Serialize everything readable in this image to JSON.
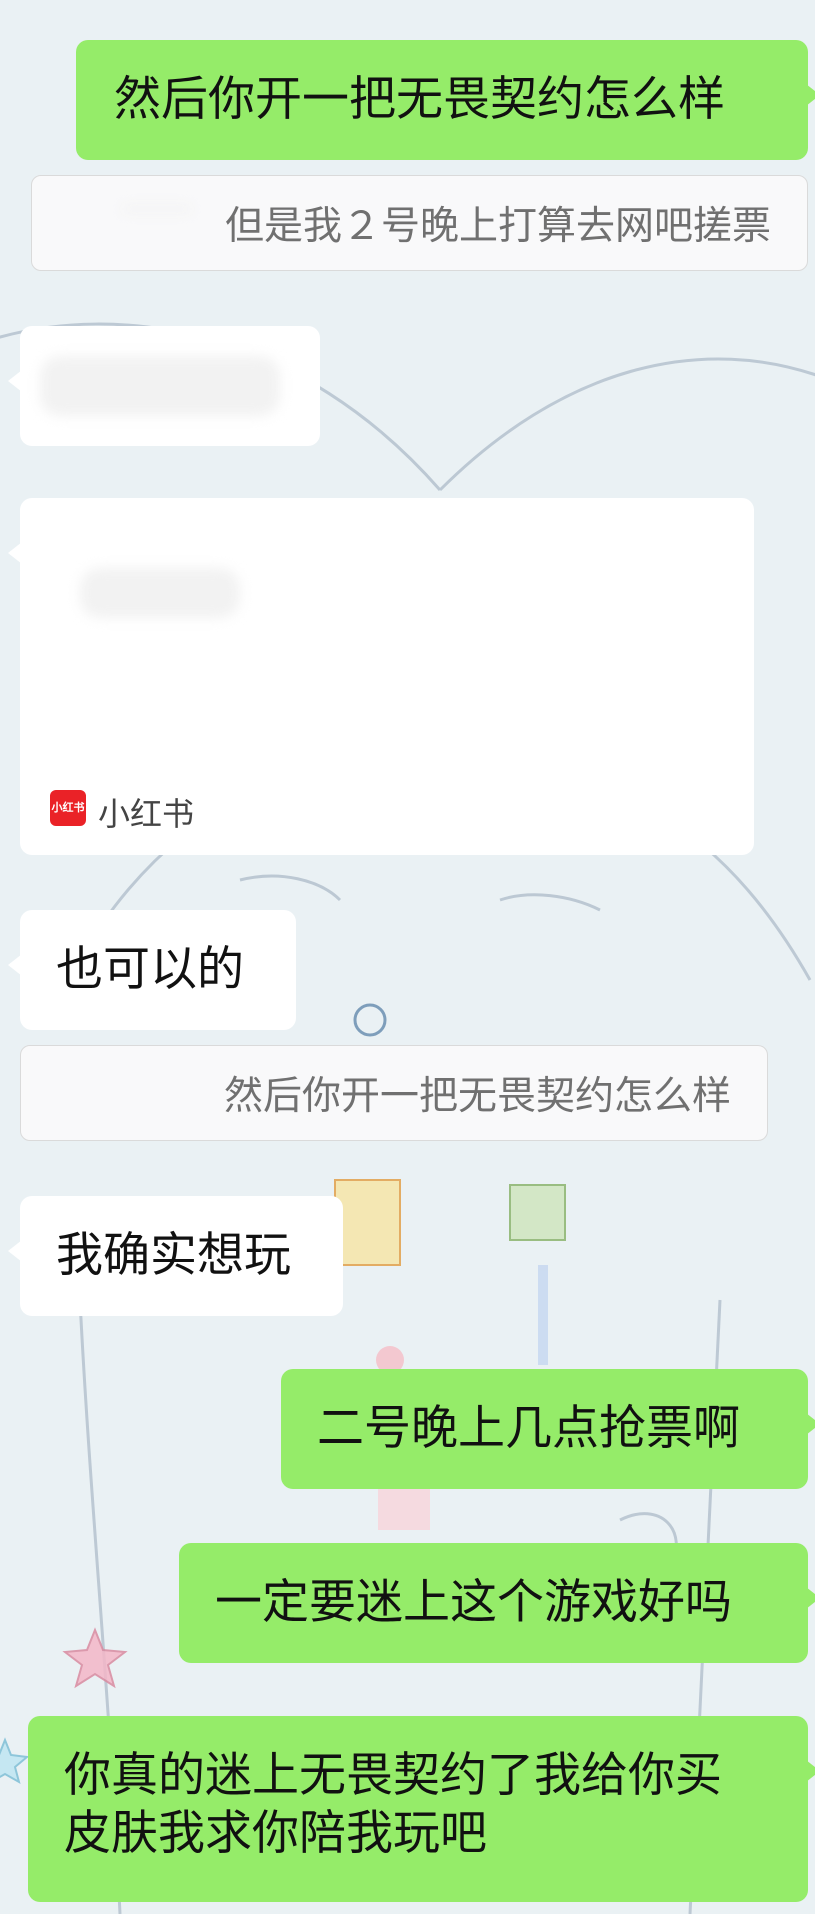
{
  "messages": [
    {
      "side": "right",
      "text": "然后你开一把无畏契约怎么样"
    },
    {
      "side": "right-quote",
      "text": "但是我２号晚上打算去网吧搓票"
    },
    {
      "side": "left",
      "text": ""
    },
    {
      "side": "left-card",
      "source": "小红书",
      "source_logo": "小红书"
    },
    {
      "side": "left",
      "text": "也可以的"
    },
    {
      "side": "left-quote",
      "text": "然后你开一把无畏契约怎么样"
    },
    {
      "side": "left",
      "text": "我确实想玩"
    },
    {
      "side": "right",
      "text": "二号晚上几点抢票啊"
    },
    {
      "side": "right",
      "text": "一定要迷上这个游戏好吗"
    },
    {
      "side": "right",
      "line1": "你真的迷上无畏契约了我给你买",
      "line2": "皮肤我求你陪我玩吧"
    }
  ],
  "colors": {
    "outgoing": "#95ec69",
    "incoming": "#ffffff",
    "quote_text": "#707070",
    "rednote_red": "#ea2227"
  }
}
